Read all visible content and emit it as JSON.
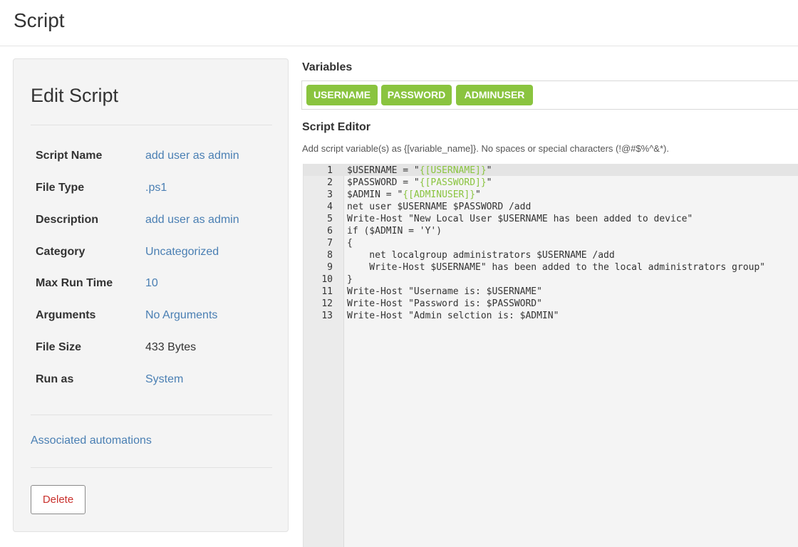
{
  "header": {
    "title": "Script"
  },
  "left": {
    "title": "Edit Script",
    "props": [
      {
        "label": "Script Name",
        "value": "add user as admin",
        "link": true
      },
      {
        "label": "File Type",
        "value": ".ps1",
        "link": true
      },
      {
        "label": "Description",
        "value": "add user as admin",
        "link": true
      },
      {
        "label": "Category",
        "value": "Uncategorized",
        "link": true
      },
      {
        "label": "Max Run Time",
        "value": "10",
        "link": true
      },
      {
        "label": "Arguments",
        "value": "No Arguments",
        "link": true
      },
      {
        "label": "File Size",
        "value": "433 Bytes",
        "link": false
      },
      {
        "label": "Run as",
        "value": "System",
        "link": true
      }
    ],
    "assoc_label": "Associated automations",
    "delete_label": "Delete"
  },
  "variables": {
    "label": "Variables",
    "items": [
      "USERNAME",
      "PASSWORD",
      "ADMINUSER"
    ]
  },
  "editor": {
    "label": "Script Editor",
    "hint": "Add script variable(s) as {[variable_name]}. No spaces or special characters (!@#$%^&*).",
    "lines": [
      {
        "n": "1",
        "pre": "$USERNAME = \"",
        "var": "{[USERNAME]}",
        "post": "\""
      },
      {
        "n": "2",
        "pre": "$PASSWORD = \"",
        "var": "{[PASSWORD]}",
        "post": "\""
      },
      {
        "n": "3",
        "pre": "$ADMIN = \"",
        "var": "{[ADMINUSER]}",
        "post": "\""
      },
      {
        "n": "4",
        "pre": "net user $USERNAME $PASSWORD /add",
        "var": "",
        "post": ""
      },
      {
        "n": "5",
        "pre": "Write-Host \"New Local User $USERNAME has been added to device\"",
        "var": "",
        "post": ""
      },
      {
        "n": "6",
        "pre": "if ($ADMIN = 'Y')",
        "var": "",
        "post": ""
      },
      {
        "n": "7",
        "pre": "{",
        "var": "",
        "post": ""
      },
      {
        "n": "8",
        "pre": "    net localgroup administrators $USERNAME /add",
        "var": "",
        "post": ""
      },
      {
        "n": "9",
        "pre": "    Write-Host $USERNAME\" has been added to the local administrators group\"",
        "var": "",
        "post": ""
      },
      {
        "n": "10",
        "pre": "}",
        "var": "",
        "post": ""
      },
      {
        "n": "11",
        "pre": "Write-Host \"Username is: $USERNAME\"",
        "var": "",
        "post": ""
      },
      {
        "n": "12",
        "pre": "Write-Host \"Password is: $PASSWORD\"",
        "var": "",
        "post": ""
      },
      {
        "n": "13",
        "pre": "Write-Host \"Admin selction is: $ADMIN\"",
        "var": "",
        "post": ""
      }
    ]
  },
  "colors": {
    "accent": "#8ac43f",
    "link": "#4a7fb3",
    "danger": "#c9302c"
  }
}
